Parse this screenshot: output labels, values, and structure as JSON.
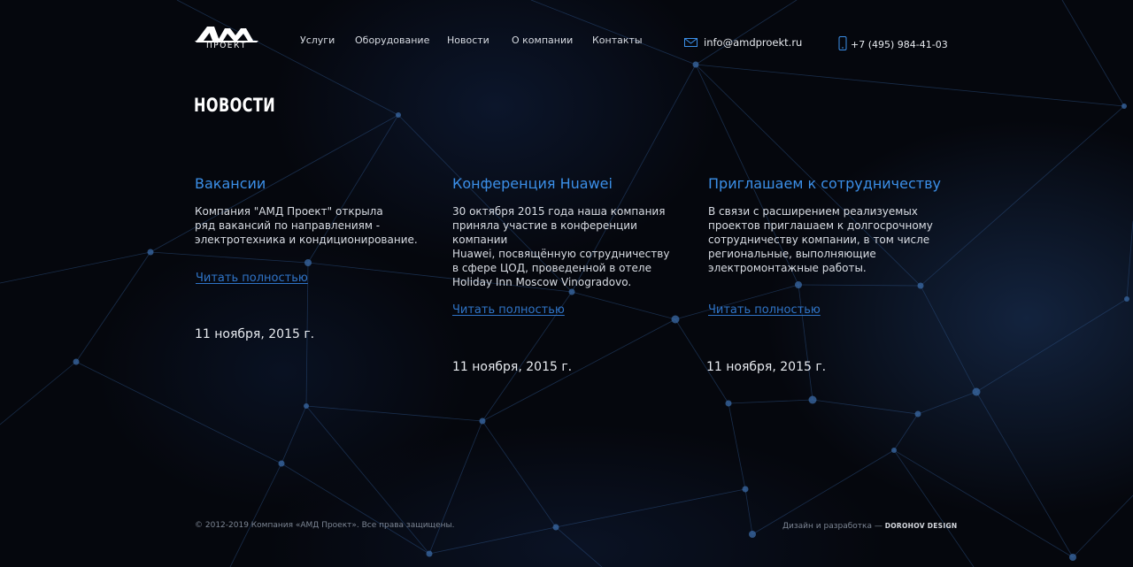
{
  "header": {
    "logo_text": "АМД",
    "logo_subtitle": "ПРОЕКТ",
    "nav": [
      {
        "label": "Услуги"
      },
      {
        "label": "Оборудование"
      },
      {
        "label": "Новости"
      },
      {
        "label": "О компании"
      },
      {
        "label": "Контакты"
      }
    ],
    "email": "info@amdproekt.ru",
    "phone": "+7 (495) 984-41-03"
  },
  "main": {
    "title": "НОВОСТИ",
    "news": [
      {
        "title": "Вакансии",
        "text": "Компания \"АМД Проект\" открыла\nряд вакансий по направлениям -\nэлектротехника и кондиционирование.",
        "link": "Читать полностью",
        "date": "11 ноября, 2015 г."
      },
      {
        "title": "Конференция Huawei",
        "text": "30 октября 2015 года наша компания\nприняла участие в конференции компании\nHuawei, посвящённую сотрудничеству\nв сфере ЦОД, проведенной в отеле\nHoliday Inn Moscow Vinogradovo.",
        "link": "Читать полностью",
        "date": "11 ноября, 2015 г."
      },
      {
        "title": "Приглашаем к сотрудничеству",
        "text": "В связи с расширением реализуемых\nпроектов приглашаем к долгосрочному\nсотрудничеству компании, в том числе\nрегиональные, выполняющие\nэлектромонтажные работы.",
        "link": "Читать полностью",
        "date": "11 ноября, 2015 г."
      }
    ]
  },
  "footer": {
    "copyright": "© 2012-2019 Компания «АМД Проект». Все права защищены.",
    "design_label": "Дизайн и разработка —",
    "design_brand": "DOROHOV DESIGN"
  },
  "colors": {
    "background": "#05070d",
    "accent": "#3b8fe8",
    "link": "#2f74c7",
    "network_line": "#2a4d7e"
  },
  "icons": [
    "mail-icon",
    "phone-icon"
  ]
}
